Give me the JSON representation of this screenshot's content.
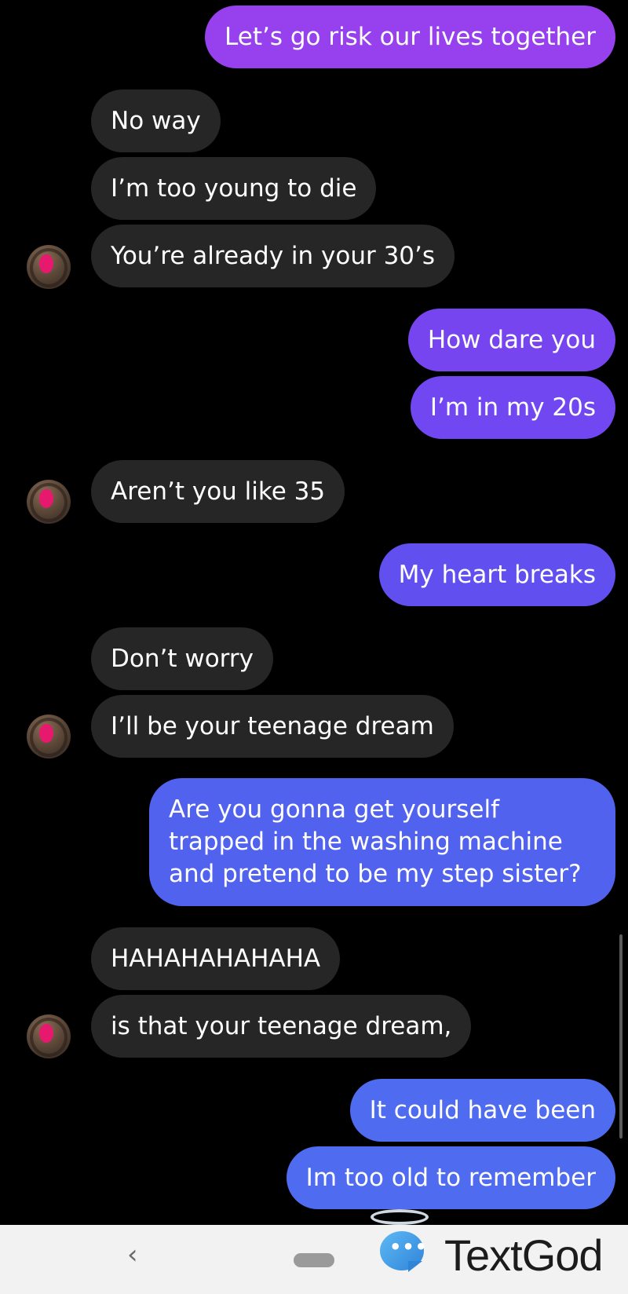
{
  "conversation": {
    "messages": [
      {
        "side": "sent",
        "text": "Let’s go risk our lives together"
      },
      {
        "side": "received",
        "text": "No way"
      },
      {
        "side": "received",
        "text": "I’m too young to die"
      },
      {
        "side": "received",
        "text": "You’re already in your 30’s"
      },
      {
        "side": "sent",
        "text": "How dare you"
      },
      {
        "side": "sent",
        "text": "I’m in my 20s"
      },
      {
        "side": "received",
        "text": "Aren’t you like 35"
      },
      {
        "side": "sent",
        "text": "My heart breaks"
      },
      {
        "side": "received",
        "text": "Don’t worry"
      },
      {
        "side": "received",
        "text": "I’ll be your teenage dream"
      },
      {
        "side": "sent",
        "text": "Are you gonna get yourself trapped in the washing machine and pretend to be my step sister?"
      },
      {
        "side": "received",
        "text": "HAHAHAHAHAHA"
      },
      {
        "side": "received",
        "text": "is that your teenage dream,"
      },
      {
        "side": "sent",
        "text": "It could have been"
      },
      {
        "side": "sent",
        "text": "Im too old to remember"
      }
    ]
  },
  "colors": {
    "sent_top": "#9b3ef0",
    "sent_mid": "#6a4ef0",
    "sent_bottom": "#4f6cf0",
    "received": "#262626",
    "background": "#000000"
  },
  "navbar": {
    "back_icon": "chevron-left-icon",
    "back_glyph": "‹"
  },
  "watermark": {
    "brand": "TextGod",
    "icon": "chat-bubble-halo-icon",
    "dots": "•••"
  }
}
